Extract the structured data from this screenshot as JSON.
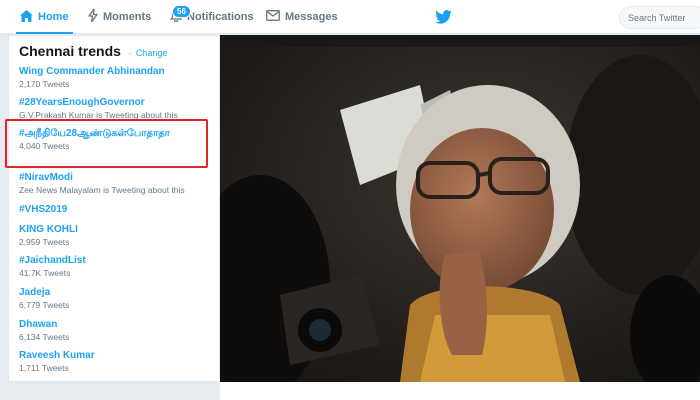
{
  "nav": {
    "home": "Home",
    "moments": "Moments",
    "notifications": "Notifications",
    "notifications_badge": "56",
    "messages": "Messages",
    "search_placeholder": "Search Twitter"
  },
  "trends": {
    "title": "Chennai trends",
    "separator": "·",
    "change": "Change",
    "items": [
      {
        "name": "Wing Commander Abhinandan",
        "meta": "2,170 Tweets"
      },
      {
        "name": "#28YearsEnoughGovernor",
        "meta": "G.V.Prakash Kumar is Tweeting about this"
      },
      {
        "name": "#அநீதியே28ஆண்டுகள்போதாதா",
        "meta": "4,040 Tweets"
      },
      {
        "name": "#NiravModi",
        "meta": "Zee News Malayalam is Tweeting about this"
      },
      {
        "name": "#VHS2019",
        "meta": ""
      },
      {
        "name": "KING KOHLI",
        "meta": "2,959 Tweets"
      },
      {
        "name": "#JaichandList",
        "meta": "41.7K Tweets"
      },
      {
        "name": "Jadeja",
        "meta": "6,779 Tweets"
      },
      {
        "name": "Dhawan",
        "meta": "6,134 Tweets"
      },
      {
        "name": "Raveesh Kumar",
        "meta": "1,711 Tweets"
      }
    ]
  },
  "icons": {
    "home": "home-icon",
    "moments": "lightning-icon",
    "notifications": "bell-icon",
    "messages": "envelope-icon",
    "logo": "twitter-bird-icon"
  },
  "colors": {
    "accent": "#1da1f2",
    "highlight_box": "#e0252c"
  }
}
